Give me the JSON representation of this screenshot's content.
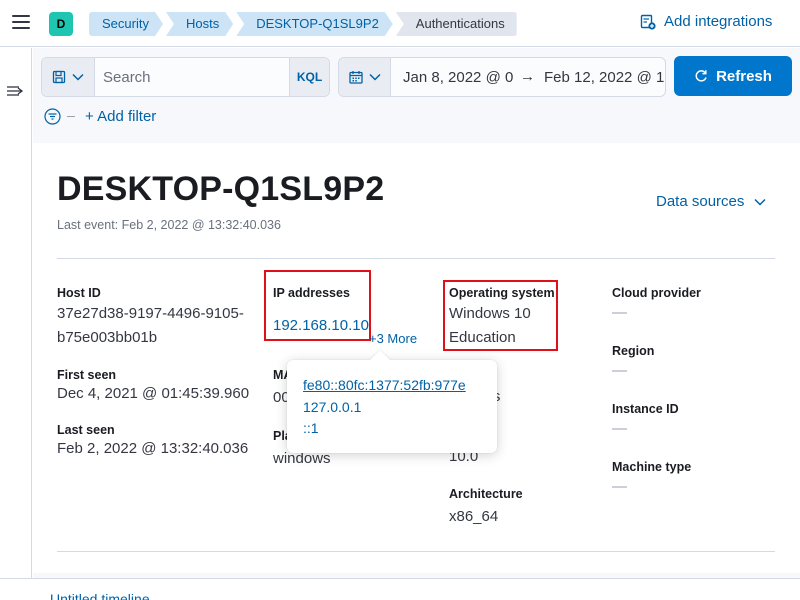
{
  "header": {
    "space_initial": "D",
    "breadcrumbs": [
      "Security",
      "Hosts",
      "DESKTOP-Q1SL9P2",
      "Authentications"
    ],
    "add_integrations": "Add integrations"
  },
  "query": {
    "search_placeholder": "Search",
    "kql_label": "KQL",
    "date_start": "Jan 8, 2022 @ 0",
    "date_arrow": "→",
    "date_end": "Feb 12, 2022 @ 1",
    "refresh_label": "Refresh",
    "add_filter": "+ Add filter"
  },
  "host": {
    "name": "DESKTOP-Q1SL9P2",
    "last_event": "Last event: Feb 2, 2022 @ 13:32:40.036",
    "data_sources": "Data sources"
  },
  "details": {
    "host_id_label": "Host ID",
    "host_id_line1": "37e27d38-9197-4496-9105-",
    "host_id_line2": "b75e003bb01b",
    "first_seen_label": "First seen",
    "first_seen_value": "Dec 4, 2021 @ 01:45:39.960",
    "last_seen_label": "Last seen",
    "last_seen_value": "Feb 2, 2022 @ 13:32:40.036",
    "ip_label": "IP addresses",
    "ip_value": "192.168.10.10",
    "more_label": "+3 More",
    "mac_label_partial": "MA",
    "mac_value_partial": "00",
    "platform_label_partial": "Pla",
    "platform_value": "windows",
    "os_label": "Operating system",
    "os_value_line1": "Windows 10",
    "os_value_line2": "Education",
    "family_value_partial": "ws",
    "version_value": "10.0",
    "architecture_label": "Architecture",
    "architecture_value": "x86_64",
    "cloud_provider_label": "Cloud provider",
    "region_label": "Region",
    "instance_id_label": "Instance ID",
    "machine_type_label": "Machine type",
    "empty_value": "—"
  },
  "popover": {
    "ips": [
      "fe80::80fc:1377:52fb:977e",
      "127.0.0.1",
      "::1"
    ]
  },
  "bottom": {
    "partial_text": "Untitled timeline"
  },
  "colors": {
    "link": "#0061a6",
    "primary_button": "#0077cc",
    "highlight_box": "#e0101a",
    "avatar": "#1ec6b2"
  }
}
